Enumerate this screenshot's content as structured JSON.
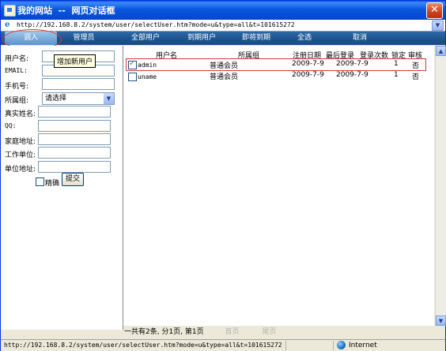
{
  "window": {
    "title": "我的网站  --  网页对话框"
  },
  "address": {
    "url": "http://192.168.8.2/system/user/selectUser.htm?mode=u&type=all&t=101615272"
  },
  "toolbar": {
    "items": [
      "调入",
      "管理员",
      "全部用户",
      "到期用户",
      "即将到期",
      "全选",
      "取消"
    ]
  },
  "tooltip": {
    "text": "增加新用户"
  },
  "form": {
    "username_label": "用户名:",
    "email_label": "EMAIL:",
    "phone_label": "手机号:",
    "group_label": "所属组:",
    "group_selected": "请选择",
    "realname_label": "真实姓名:",
    "qq_label": "QQ:",
    "address_label": "家庭地址:",
    "company_label": "工作单位:",
    "company_addr_label": "单位地址:",
    "exact_label": "精确",
    "submit_label": "提交"
  },
  "table": {
    "headers": [
      "用户名",
      "所属组",
      "注册日期",
      "最后登录",
      "登录次数",
      "锁定",
      "审核"
    ],
    "rows": [
      {
        "checked": true,
        "username": "admin",
        "group": "普通会员",
        "reg_date": "2009-7-9",
        "last_login": "2009-7-9",
        "login_count": "1",
        "locked": "",
        "review": "否"
      },
      {
        "checked": false,
        "username": "uname",
        "group": "普通会员",
        "reg_date": "2009-7-9",
        "last_login": "2009-7-9",
        "login_count": "1",
        "locked": "",
        "review": "否"
      }
    ]
  },
  "pager": {
    "summary": "一共有2条, 分1页, 第1页",
    "first": "首页",
    "last": "尾页"
  },
  "status": {
    "url": "http://192.168.8.2/system/user/selectUser.htm?mode=u&type=all&t=101615272",
    "zone": "Internet"
  }
}
